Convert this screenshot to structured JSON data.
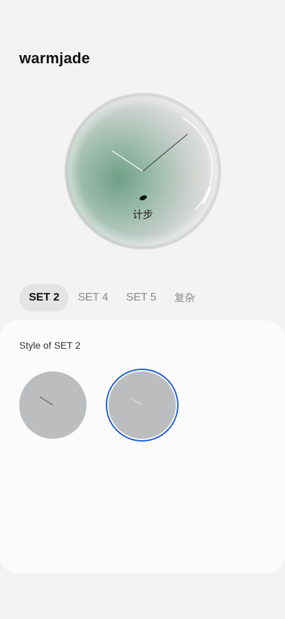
{
  "header": {
    "title": "warmjade"
  },
  "preview": {
    "complication_label": "计步"
  },
  "tabs": [
    {
      "label": "SET 2",
      "active": true
    },
    {
      "label": "SET 4",
      "active": false
    },
    {
      "label": "SET 5",
      "active": false
    },
    {
      "label": "复杂",
      "active": false
    }
  ],
  "style_panel": {
    "heading": "Style of SET 2",
    "options": [
      {
        "name": "style-1",
        "selected": false
      },
      {
        "name": "style-2",
        "selected": true
      }
    ],
    "selection_color": "#1f5fd6"
  },
  "colors": {
    "background": "#f3f3f3",
    "card": "#fbfbfb",
    "jade": "#7fae97",
    "option_fill": "#bcbdbf"
  }
}
